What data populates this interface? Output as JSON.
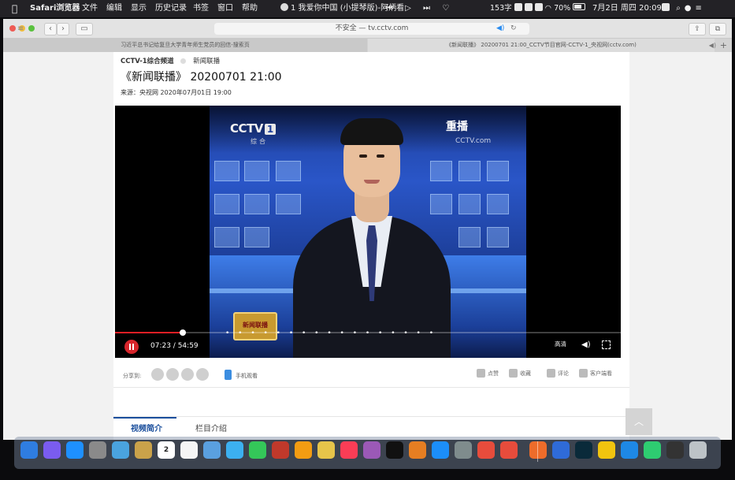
{
  "menubar": {
    "app_name": "Safari浏览器",
    "menus": [
      "文件",
      "编辑",
      "显示",
      "历史记录",
      "书签",
      "窗口",
      "帮助"
    ],
    "now_playing": "1 我爱你中国 (小提琴版)-阿炳看",
    "media_controls": "⏮ ▷ ⏭ ♡",
    "word_count": "153字",
    "battery_percent": "70%",
    "datetime": "7月2日 周四 20:09"
  },
  "toolbar": {
    "address_text": "不安全 — tv.cctv.com",
    "back_glyph": "‹",
    "forward_glyph": "›",
    "sidebar_glyph": "▭",
    "share_glyph": "⇪",
    "tabs_glyph": "⧉"
  },
  "tabs": [
    {
      "label": "习近平总书记给复旦大学青年师生党员的回信-搜索页"
    },
    {
      "label": "《新闻联播》 20200701 21:00_CCTV节目官网-CCTV-1_央视网(cctv.com)"
    }
  ],
  "page": {
    "breadcrumb_channel": "CCTV-1综合频道",
    "breadcrumb_program": "新闻联播",
    "title": "《新闻联播》 20200701 21:00",
    "source": "来源：央视网  2020年07月01日 19:00"
  },
  "player": {
    "logo_text": "CCTV",
    "logo_number": "1",
    "logo_sub": "综合",
    "rebroadcast": "重播",
    "watermark": "CCTV",
    "watermark_suffix": ".com",
    "program_logo": "新闻联播",
    "current_time": "07:23",
    "duration": "54:59",
    "progress_fraction": 0.134,
    "quality": "高清",
    "chapter_marks": "•  • • • •  • •  • • •  • • • • •  • •"
  },
  "share": {
    "label": "分享到:",
    "mobile_label": "手机观看",
    "like": "点赞",
    "favorite": "收藏",
    "comment": "评论",
    "client": "客户端看"
  },
  "content_tabs": [
    {
      "label": "视频简介",
      "active": true
    },
    {
      "label": "栏目介绍",
      "active": false
    }
  ],
  "colors": {
    "accent_red": "#e31e24",
    "link_blue": "#1a4e9c",
    "menubar_bg": "#232226"
  },
  "dock": {
    "icons": [
      "finder-icon",
      "siri-icon",
      "safari-icon",
      "launchpad-icon",
      "preview-icon",
      "notes-icon",
      "calendar-icon",
      "reminders-icon",
      "photos-icon",
      "messages-icon",
      "facetime-icon",
      "photobooth-icon",
      "photos2-icon",
      "stickies-icon",
      "music-icon",
      "podcasts-icon",
      "appletv-icon",
      "books-icon",
      "appstore-icon",
      "systemprefs-icon",
      "blocked-icon",
      "blocked2-icon",
      "office-icon",
      "wps-icon",
      "audition-icon",
      "qqmusic-icon",
      "qq-icon",
      "wechat-icon",
      "screenshot-icon",
      "trash-icon"
    ],
    "calendar_day": "2"
  }
}
